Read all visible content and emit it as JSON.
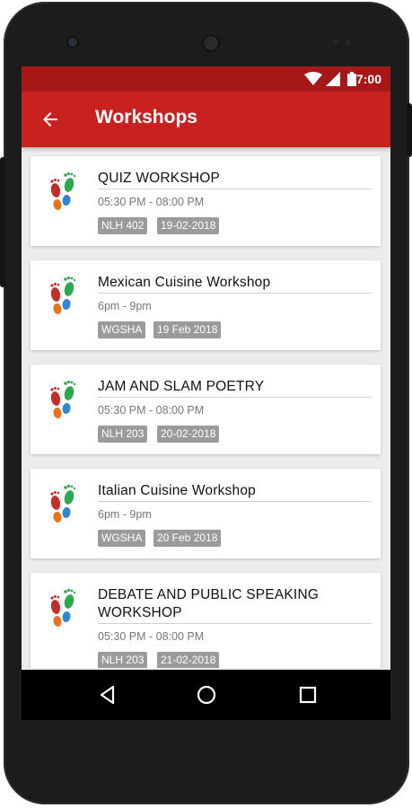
{
  "status_bar": {
    "time": "7:00",
    "icons": [
      "wifi-icon",
      "signal-icon",
      "battery-icon"
    ],
    "color": "#a81717"
  },
  "app_bar": {
    "title": "Workshops",
    "back_icon": "arrow-left-icon",
    "color": "#c9211e"
  },
  "workshops": [
    {
      "title": "QUIZ WORKSHOP",
      "time": "05:30 PM - 08:00 PM",
      "venue": "NLH 402",
      "date": "19-02-2018"
    },
    {
      "title": "Mexican Cuisine Workshop",
      "time": "6pm - 9pm",
      "venue": "WGSHA",
      "date": "19 Feb 2018"
    },
    {
      "title": "JAM AND SLAM POETRY",
      "time": "05:30 PM - 08:00 PM",
      "venue": "NLH 203",
      "date": "20-02-2018"
    },
    {
      "title": "Italian Cuisine Workshop",
      "time": "6pm - 9pm",
      "venue": "WGSHA",
      "date": "20 Feb 2018"
    },
    {
      "title": "DEBATE AND PUBLIC SPEAKING WORKSHOP",
      "time": "05:30 PM - 08:00 PM",
      "venue": "NLH 203",
      "date": "21-02-2018"
    }
  ],
  "workshop_icon": "footprints-icon",
  "nav_bar": {
    "buttons": [
      "back-triangle-icon",
      "home-circle-icon",
      "recents-square-icon"
    ]
  },
  "badge_color": "#9b9b9b"
}
